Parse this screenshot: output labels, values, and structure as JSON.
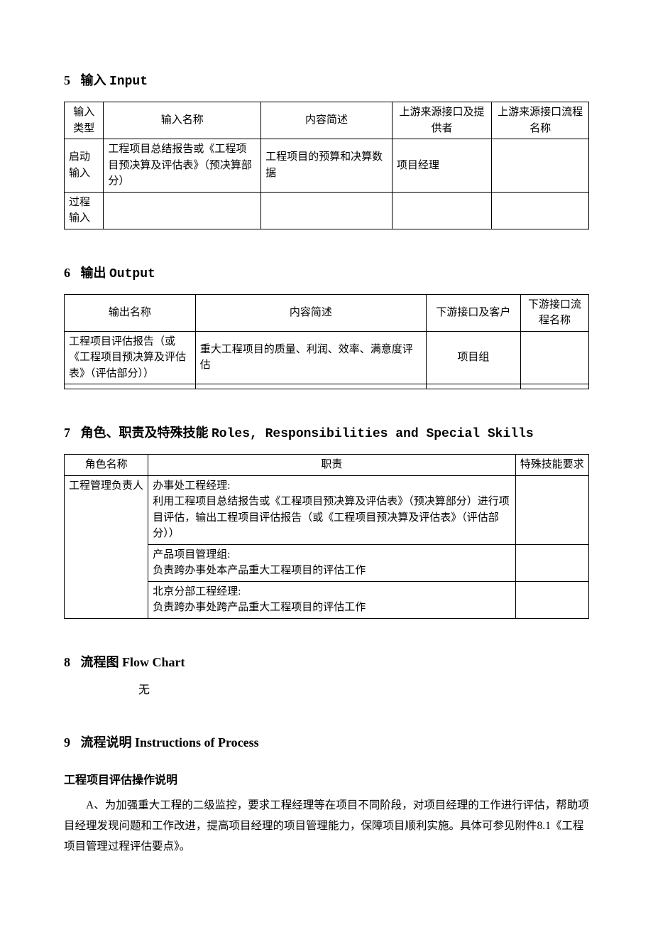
{
  "section5": {
    "num": "5",
    "title_cn": "输入",
    "title_en": "Input",
    "headers": {
      "h1": "输入类型",
      "h2": "输入名称",
      "h3": "内容简述",
      "h4": "上游来源接口及提供者",
      "h5": "上游来源接口流程名称"
    },
    "row1": {
      "c1": "启动输入",
      "c2": "工程项目总结报告或《工程项目预决算及评估表》（预决算部分）",
      "c3": "工程项目的预算和决算数据",
      "c4": "项目经理",
      "c5": ""
    },
    "row2": {
      "c1": "过程输入",
      "c2": "",
      "c3": "",
      "c4": "",
      "c5": ""
    }
  },
  "section6": {
    "num": "6",
    "title_cn": "输出",
    "title_en": "Output",
    "headers": {
      "h1": "输出名称",
      "h2": "内容简述",
      "h3": "下游接口及客户",
      "h4": "下游接口流程名称"
    },
    "row1": {
      "c1": "工程项目评估报告（或《工程项目预决算及评估表》（评估部分））",
      "c2": "重大工程项目的质量、利润、效率、满意度评估",
      "c3": "项目组",
      "c4": ""
    },
    "row2": {
      "c1": "",
      "c2": "",
      "c3": "",
      "c4": ""
    }
  },
  "section7": {
    "num": "7",
    "title_cn": "角色、职责及特殊技能",
    "title_en": "Roles, Responsibilities and Special Skills",
    "headers": {
      "h1": "角色名称",
      "h2": "职责",
      "h3": "特殊技能要求"
    },
    "row1_c1": "工程管理负责人",
    "duty1": "办事处工程经理:\n利用工程项目总结报告或《工程项目预决算及评估表》（预决算部分）进行项目评估，输出工程项目评估报告（或《工程项目预决算及评估表》（评估部分））",
    "duty2": "产品项目管理组:\n负责跨办事处本产品重大工程项目的评估工作",
    "duty3": "北京分部工程经理:\n负责跨办事处跨产品重大工程项目的评估工作"
  },
  "section8": {
    "num": "8",
    "title_cn": "流程图",
    "title_en": "Flow Chart",
    "body": "无"
  },
  "section9": {
    "num": "9",
    "title_cn": "流程说明",
    "title_en": "Instructions of   Process",
    "sub_heading": "工程项目评估操作说明",
    "paragraph": "A、为加强重大工程的二级监控，要求工程经理等在项目不同阶段，对项目经理的工作进行评估，帮助项目经理发现问题和工作改进，提高项目经理的项目管理能力，保障项目顺利实施。具体可参见附件8.1《工程项目管理过程评估要点》。"
  }
}
